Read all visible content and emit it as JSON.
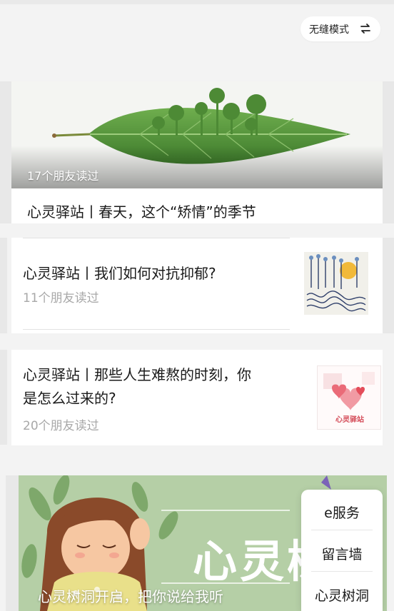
{
  "header": {
    "mode_label": "无缝模式"
  },
  "articles": [
    {
      "title": "心灵驿站丨春天，这个“矫情”的季节",
      "reads": "17个朋友读过"
    },
    {
      "title": "心灵驿站丨我们如何对抗抑郁?",
      "reads": "11个朋友读过"
    },
    {
      "title_line1": "心灵驿站丨那些人生难熬的时刻，你",
      "title_line2": "是怎么过来的?",
      "reads": "20个朋友读过",
      "thumb_text": "心灵驿站"
    }
  ],
  "banner": {
    "caption": "心灵树洞开启，把你说给我听",
    "big_text": "心灵树"
  },
  "float_menu": {
    "items": [
      "e服务",
      "留言墙",
      "心灵树洞"
    ]
  },
  "colors": {
    "accent_green": "#4f8f3a",
    "read_gray": "#a8a8a8"
  }
}
